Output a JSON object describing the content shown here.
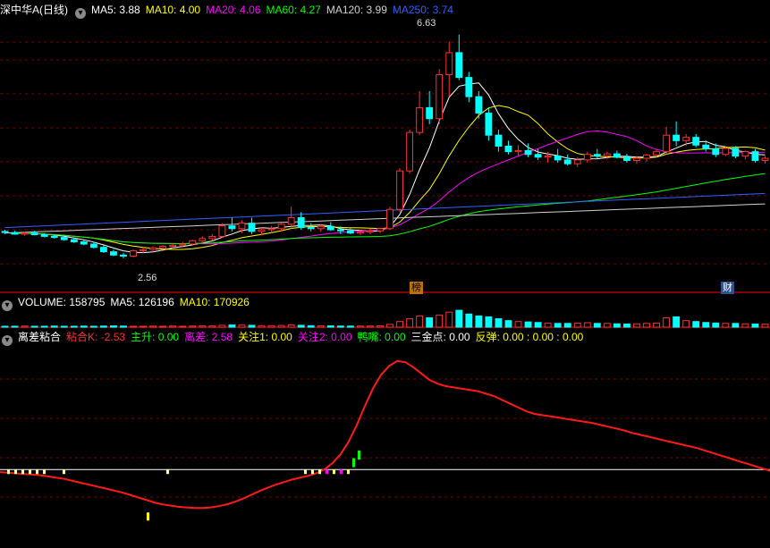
{
  "header": {
    "stock": "深中华A(日线)",
    "ma": [
      {
        "label": "MA5:",
        "value": "3.88",
        "color": "#ffffff"
      },
      {
        "label": "MA10:",
        "value": "4.00",
        "color": "#ffff00"
      },
      {
        "label": "MA20:",
        "value": "4.06",
        "color": "#ff00ff"
      },
      {
        "label": "MA60:",
        "value": "4.27",
        "color": "#00ff00"
      },
      {
        "label": "MA120:",
        "value": "3.99",
        "color": "#d0d0d0"
      },
      {
        "label": "MA250:",
        "value": "3.74",
        "color": "#3060ff"
      }
    ]
  },
  "volume_header": [
    {
      "label": "VOLUME:",
      "value": "158795",
      "color": "#ffffff"
    },
    {
      "label": "MA5:",
      "value": "126196",
      "color": "#ffffff"
    },
    {
      "label": "MA10:",
      "value": "170926",
      "color": "#ffff00"
    }
  ],
  "indicator_header": {
    "name": "离差粘合",
    "items": [
      {
        "label": "粘合K:",
        "value": "-2.53",
        "color": "#ff3030"
      },
      {
        "label": "主升:",
        "value": "0.00",
        "color": "#00ff00"
      },
      {
        "label": "离差:",
        "value": "2.58",
        "color": "#ff00ff"
      },
      {
        "label": "关注1:",
        "value": "0.00",
        "color": "#ffff00"
      },
      {
        "label": "关注2:",
        "value": "0.00",
        "color": "#ff00ff"
      },
      {
        "label": "鸭嘴:",
        "value": "0.00",
        "color": "#00ff00"
      },
      {
        "label": "三金点:",
        "value": "0.00",
        "color": "#ffffff"
      },
      {
        "label": "反弹:",
        "value": "0.00 : 0.00 : 0.00",
        "color": "#ffff00"
      }
    ]
  },
  "annotations": {
    "high": "6.63",
    "low": "2.56",
    "tag1": "榜",
    "tag2": "财"
  },
  "colors": {
    "up": "#ff3030",
    "down": "#00ffff",
    "grid": "#7a0000",
    "border": "#b00000",
    "zero": "#ffffff"
  },
  "chart_data": {
    "type": "candlestick",
    "y_range": [
      2.3,
      6.9
    ],
    "candles": [
      [
        3.05,
        3.08,
        3.0,
        3.03
      ],
      [
        3.03,
        3.06,
        2.99,
        3.0
      ],
      [
        3.0,
        3.04,
        2.97,
        3.02
      ],
      [
        3.02,
        3.06,
        2.98,
        2.99
      ],
      [
        2.99,
        3.02,
        2.94,
        2.96
      ],
      [
        2.96,
        3.0,
        2.92,
        2.94
      ],
      [
        2.94,
        2.98,
        2.88,
        2.9
      ],
      [
        2.9,
        2.93,
        2.84,
        2.86
      ],
      [
        2.86,
        2.9,
        2.8,
        2.82
      ],
      [
        2.82,
        2.86,
        2.74,
        2.76
      ],
      [
        2.76,
        2.8,
        2.66,
        2.68
      ],
      [
        2.68,
        2.72,
        2.6,
        2.62
      ],
      [
        2.62,
        2.66,
        2.56,
        2.6
      ],
      [
        2.6,
        2.72,
        2.58,
        2.7
      ],
      [
        2.7,
        2.76,
        2.66,
        2.72
      ],
      [
        2.72,
        2.78,
        2.68,
        2.75
      ],
      [
        2.75,
        2.8,
        2.72,
        2.78
      ],
      [
        2.78,
        2.84,
        2.74,
        2.8
      ],
      [
        2.8,
        2.86,
        2.76,
        2.82
      ],
      [
        2.82,
        2.9,
        2.8,
        2.88
      ],
      [
        2.88,
        2.96,
        2.84,
        2.92
      ],
      [
        2.92,
        3.0,
        2.88,
        2.96
      ],
      [
        2.96,
        3.2,
        2.94,
        3.15
      ],
      [
        3.15,
        3.3,
        3.05,
        3.1
      ],
      [
        3.1,
        3.25,
        3.02,
        3.2
      ],
      [
        3.2,
        3.3,
        3.0,
        3.05
      ],
      [
        3.05,
        3.12,
        2.98,
        3.08
      ],
      [
        3.08,
        3.15,
        3.02,
        3.1
      ],
      [
        3.1,
        3.2,
        3.05,
        3.18
      ],
      [
        3.18,
        3.5,
        3.1,
        3.3
      ],
      [
        3.3,
        3.4,
        3.08,
        3.12
      ],
      [
        3.12,
        3.2,
        3.05,
        3.1
      ],
      [
        3.1,
        3.18,
        3.04,
        3.14
      ],
      [
        3.14,
        3.22,
        3.06,
        3.08
      ],
      [
        3.08,
        3.14,
        3.0,
        3.06
      ],
      [
        3.06,
        3.12,
        3.0,
        3.02
      ],
      [
        3.02,
        3.08,
        2.98,
        3.04
      ],
      [
        3.04,
        3.1,
        3.0,
        3.06
      ],
      [
        3.06,
        3.12,
        3.02,
        3.1
      ],
      [
        3.1,
        3.5,
        3.08,
        3.45
      ],
      [
        3.45,
        4.2,
        3.4,
        4.15
      ],
      [
        4.15,
        4.9,
        4.1,
        4.85
      ],
      [
        4.85,
        5.6,
        4.8,
        5.3
      ],
      [
        5.3,
        5.6,
        5.0,
        5.1
      ],
      [
        5.1,
        6.0,
        5.0,
        5.9
      ],
      [
        5.9,
        6.5,
        5.5,
        6.3
      ],
      [
        6.3,
        6.63,
        5.8,
        5.85
      ],
      [
        5.85,
        5.95,
        5.4,
        5.5
      ],
      [
        5.5,
        5.6,
        5.1,
        5.2
      ],
      [
        5.2,
        5.3,
        4.7,
        4.8
      ],
      [
        4.8,
        4.9,
        4.5,
        4.6
      ],
      [
        4.6,
        4.7,
        4.45,
        4.5
      ],
      [
        4.5,
        4.62,
        4.42,
        4.52
      ],
      [
        4.52,
        4.65,
        4.4,
        4.45
      ],
      [
        4.45,
        4.55,
        4.35,
        4.4
      ],
      [
        4.4,
        4.5,
        4.3,
        4.42
      ],
      [
        4.42,
        4.55,
        4.3,
        4.35
      ],
      [
        4.35,
        4.45,
        4.25,
        4.28
      ],
      [
        4.28,
        4.4,
        4.22,
        4.35
      ],
      [
        4.35,
        4.5,
        4.3,
        4.45
      ],
      [
        4.45,
        4.55,
        4.38,
        4.42
      ],
      [
        4.42,
        4.5,
        4.36,
        4.46
      ],
      [
        4.46,
        4.52,
        4.38,
        4.4
      ],
      [
        4.4,
        4.46,
        4.3,
        4.34
      ],
      [
        4.34,
        4.42,
        4.28,
        4.38
      ],
      [
        4.38,
        4.46,
        4.32,
        4.44
      ],
      [
        4.44,
        4.55,
        4.4,
        4.5
      ],
      [
        4.5,
        4.95,
        4.45,
        4.8
      ],
      [
        4.8,
        5.05,
        4.6,
        4.7
      ],
      [
        4.7,
        4.82,
        4.6,
        4.76
      ],
      [
        4.76,
        4.82,
        4.58,
        4.62
      ],
      [
        4.62,
        4.7,
        4.5,
        4.55
      ],
      [
        4.55,
        4.65,
        4.4,
        4.45
      ],
      [
        4.45,
        4.6,
        4.42,
        4.56
      ],
      [
        4.56,
        4.6,
        4.38,
        4.42
      ],
      [
        4.42,
        4.52,
        4.36,
        4.5
      ],
      [
        4.5,
        4.55,
        4.3,
        4.34
      ],
      [
        4.34,
        4.42,
        4.28,
        4.38
      ]
    ],
    "volume": [
      0.05,
      0.05,
      0.06,
      0.05,
      0.05,
      0.06,
      0.05,
      0.05,
      0.06,
      0.05,
      0.06,
      0.07,
      0.06,
      0.05,
      0.05,
      0.06,
      0.05,
      0.06,
      0.05,
      0.06,
      0.07,
      0.07,
      0.1,
      0.12,
      0.11,
      0.1,
      0.08,
      0.08,
      0.09,
      0.12,
      0.1,
      0.08,
      0.07,
      0.07,
      0.06,
      0.06,
      0.06,
      0.06,
      0.07,
      0.15,
      0.3,
      0.45,
      0.6,
      0.5,
      0.65,
      0.8,
      0.9,
      0.7,
      0.6,
      0.55,
      0.45,
      0.35,
      0.3,
      0.28,
      0.25,
      0.22,
      0.2,
      0.2,
      0.22,
      0.24,
      0.2,
      0.2,
      0.18,
      0.17,
      0.18,
      0.2,
      0.22,
      0.5,
      0.55,
      0.35,
      0.3,
      0.25,
      0.22,
      0.2,
      0.2,
      0.18,
      0.17,
      0.16
    ],
    "indicator": {
      "y_range": [
        -6,
        10
      ],
      "line": [
        -0.2,
        -0.25,
        -0.3,
        -0.35,
        -0.4,
        -0.45,
        -0.55,
        -0.65,
        -0.75,
        -0.9,
        -1.05,
        -1.2,
        -1.35,
        -1.5,
        -1.65,
        -1.8,
        -2.0,
        -2.2,
        -2.4,
        -2.6,
        -2.75,
        -2.85,
        -2.95,
        -3.0,
        -3.05,
        -3.05,
        -3.0,
        -2.9,
        -2.75,
        -2.55,
        -2.3,
        -2.0,
        -1.7,
        -1.45,
        -1.2,
        -1.0,
        -0.8,
        -0.65,
        -0.5,
        -0.3,
        0.0,
        0.5,
        1.2,
        2.2,
        3.5,
        5.0,
        6.4,
        7.5,
        8.2,
        8.6,
        8.5,
        8.1,
        7.6,
        7.1,
        6.8,
        6.6,
        6.5,
        6.4,
        6.3,
        6.2,
        6.0,
        5.8,
        5.5,
        5.2,
        4.9,
        4.6,
        4.4,
        4.3,
        4.2,
        4.1,
        4.0,
        3.9,
        3.8,
        3.7,
        3.55,
        3.4,
        3.25,
        3.1,
        2.9,
        2.75,
        2.6,
        2.45,
        2.3,
        2.15,
        2.0,
        1.85,
        1.7,
        1.5,
        1.3,
        1.1,
        0.9,
        0.7,
        0.5,
        0.3,
        0.1,
        -0.1
      ]
    }
  }
}
